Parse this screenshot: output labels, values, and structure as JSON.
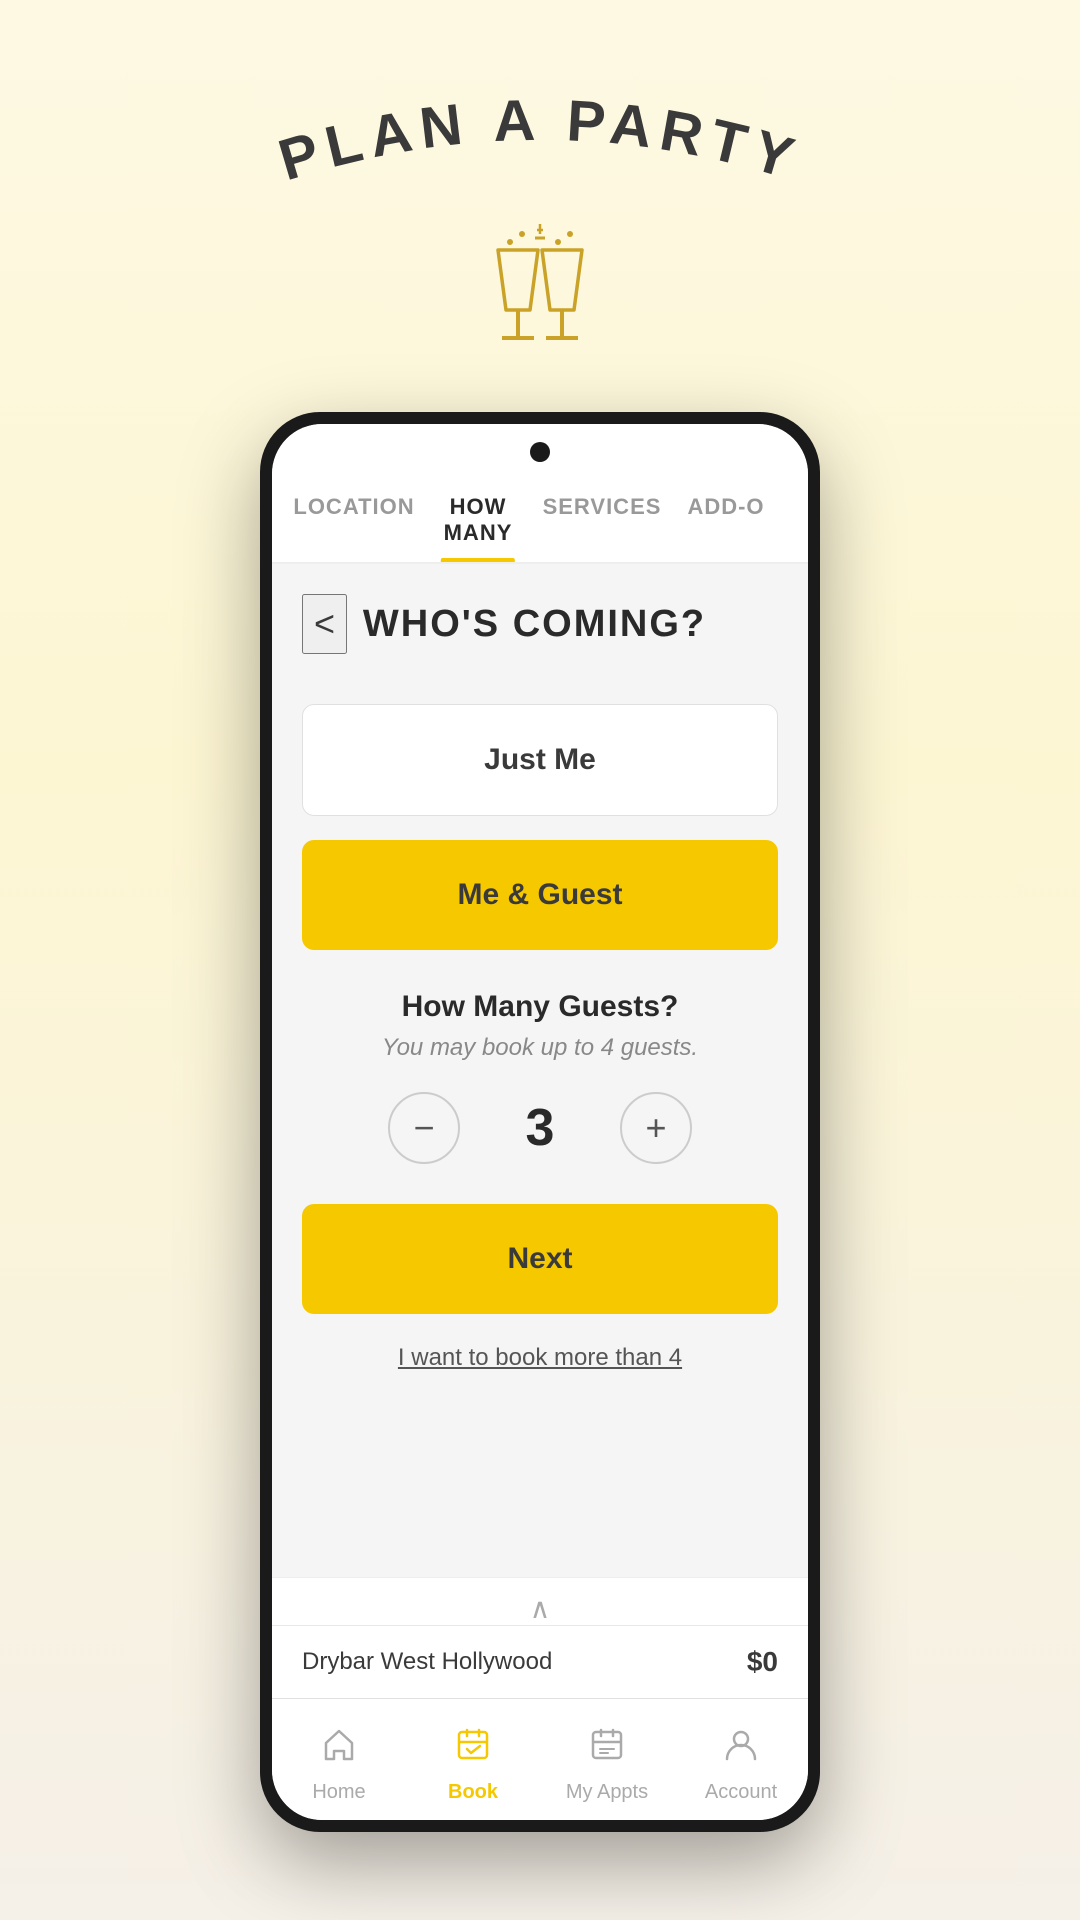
{
  "app": {
    "title": "PLAN A PARTY"
  },
  "tabs": [
    {
      "id": "location",
      "label": "LOCATION",
      "active": false
    },
    {
      "id": "how-many",
      "label": "HOW MANY",
      "active": true
    },
    {
      "id": "services",
      "label": "SERVICES",
      "active": false
    },
    {
      "id": "add-ons",
      "label": "ADD-O",
      "active": false
    }
  ],
  "page": {
    "title": "WHO'S COMING?",
    "back_label": "<"
  },
  "options": {
    "just_me": "Just Me",
    "me_guest": "Me & Guest"
  },
  "guests": {
    "section_title": "How Many Guests?",
    "subtitle": "You may book up to 4 guests.",
    "count": "3",
    "minus_label": "−",
    "plus_label": "+"
  },
  "next_button": "Next",
  "book_more_link": "I want to book more than 4",
  "bottom_bar": {
    "location": "Drybar West Hollywood",
    "price": "$0",
    "up_arrow": "∧"
  },
  "bottom_nav": [
    {
      "id": "home",
      "label": "Home",
      "icon": "🏠",
      "active": false
    },
    {
      "id": "book",
      "label": "Book",
      "icon": "📅",
      "active": true
    },
    {
      "id": "my-appts",
      "label": "My Appts",
      "icon": "📋",
      "active": false
    },
    {
      "id": "account",
      "label": "Account",
      "icon": "👤",
      "active": false
    }
  ]
}
